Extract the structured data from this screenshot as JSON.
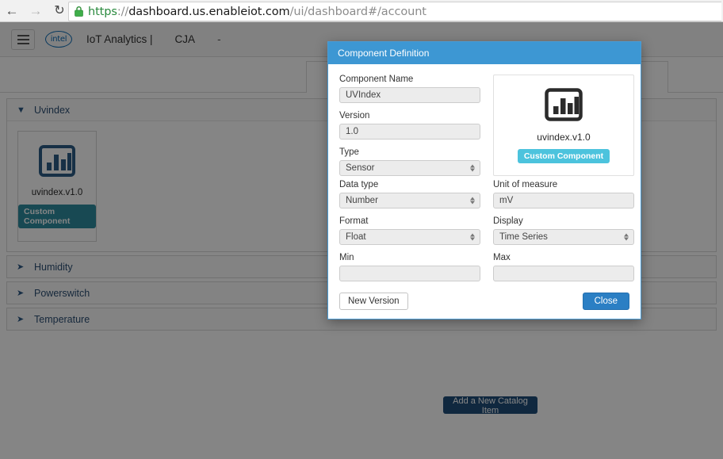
{
  "browser": {
    "back_icon": "arrow-left-icon",
    "forward_icon": "arrow-right-icon",
    "reload_icon": "reload-icon",
    "lock_icon": "lock-icon",
    "url_scheme": "https",
    "url_separator": "://",
    "url_host": "dashboard.us.enableiot.com",
    "url_path": "/ui/dashboard#/account",
    "url_full": "https://dashboard.us.enableiot.com/ui/dashboard#/account"
  },
  "navbar": {
    "menu_icon": "hamburger-icon",
    "logo_text": "intel",
    "brand_title": "IoT Analytics |",
    "account_name": "CJA",
    "caret": "-"
  },
  "tabs": [
    {
      "label": ""
    },
    {
      "label": ""
    }
  ],
  "catalog": {
    "panels": [
      {
        "title": "Uvindex",
        "caret": "❯",
        "expanded": true,
        "components": [
          {
            "name": "uvindex.v1.0",
            "badge": "Custom Component",
            "icon": "bar-chart-icon"
          }
        ]
      },
      {
        "title": "Humidity",
        "caret": "❯",
        "expanded": false,
        "components": []
      },
      {
        "title": "Powerswitch",
        "caret": "❯",
        "expanded": false,
        "components": []
      },
      {
        "title": "Temperature",
        "caret": "❯",
        "expanded": false,
        "components": []
      }
    ],
    "add_button_label": "Add a New Catalog Item"
  },
  "modal": {
    "title": "Component Definition",
    "fields": {
      "component_name": {
        "label": "Component Name",
        "value": "UVIndex",
        "type": "text"
      },
      "version": {
        "label": "Version",
        "value": "1.0",
        "type": "text"
      },
      "type": {
        "label": "Type",
        "value": "Sensor",
        "type": "select"
      },
      "data_type": {
        "label": "Data type",
        "value": "Number",
        "type": "select"
      },
      "unit_of_measure": {
        "label": "Unit of measure",
        "value": "mV",
        "type": "text"
      },
      "format": {
        "label": "Format",
        "value": "Float",
        "type": "select"
      },
      "display": {
        "label": "Display",
        "value": "Time Series",
        "type": "select"
      },
      "min": {
        "label": "Min",
        "value": "",
        "type": "text"
      },
      "max": {
        "label": "Max",
        "value": "",
        "type": "text"
      }
    },
    "preview": {
      "icon": "bar-chart-icon",
      "name": "uvindex.v1.0",
      "badge": "Custom Component"
    },
    "footer": {
      "new_version_label": "New Version",
      "close_label": "Close"
    }
  },
  "colors": {
    "modal_header": "#3d97d3",
    "modal_border": "#4a9bd4",
    "primary_button": "#2b7fc4",
    "badge_modal": "#4cc3dd",
    "badge_page": "#2e8ca0",
    "catalog_button": "#1f4e79",
    "url_secure": "#2a8a3e",
    "accordion_text": "#2c4f74"
  }
}
